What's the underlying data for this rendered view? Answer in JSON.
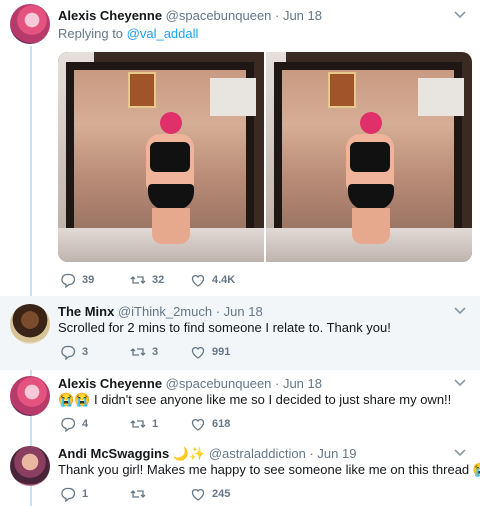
{
  "tweets": [
    {
      "name": "Alexis Cheyenne",
      "meta": "@spacebunqueen · Jun 18",
      "reply_prefix": "Replying to ",
      "reply_handle": "@val_addall",
      "replies": "39",
      "retweets": "32",
      "likes": "4.4K"
    },
    {
      "name": "The Minx",
      "meta": "@iThink_2much · Jun 18",
      "text": "Scrolled for 2 mins to find someone I relate to. Thank you!",
      "replies": "3",
      "retweets": "3",
      "likes": "991"
    },
    {
      "name": "Alexis Cheyenne",
      "meta": "@spacebunqueen · Jun 18",
      "text": "😭😭 I didn't see anyone like me so I decided to just share my own!!",
      "replies": "4",
      "retweets": "1",
      "likes": "618"
    },
    {
      "name": "Andi McSwaggins 🌙✨",
      "meta": "@astraladdiction · Jun 19",
      "text": "Thank you girl! Makes me happy to see someone like me on this thread 😭",
      "replies": "1",
      "retweets": "",
      "likes": "245"
    }
  ],
  "icons": {
    "reply": "reply-icon",
    "retweet": "retweet-icon",
    "like": "heart-icon",
    "more": "chevron-down-icon"
  },
  "colors": {
    "link": "#1da1f2",
    "muted": "#657786",
    "thread_line": "#c4e3fb",
    "highlight_bg": "#f2f6f9"
  }
}
